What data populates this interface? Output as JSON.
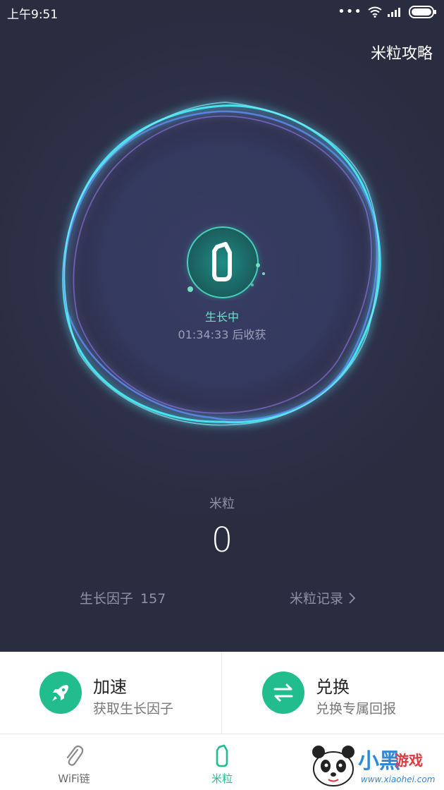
{
  "status_bar": {
    "time": "上午9:51",
    "more_icon": "more-dots-icon",
    "wifi_icon": "wifi-icon",
    "signal_icon": "signal-icon",
    "battery_icon": "battery-icon"
  },
  "header": {
    "guide_link": "米粒攻略"
  },
  "growth": {
    "state": "生长中",
    "countdown": "01:34:33 后收获"
  },
  "grain": {
    "title": "米粒",
    "value": "0"
  },
  "growth_factor": {
    "label": "生长因子",
    "value": "157"
  },
  "record_link": {
    "label": "米粒记录"
  },
  "actions": [
    {
      "title": "加速",
      "subtitle": "获取生长因子",
      "icon": "rocket-icon"
    },
    {
      "title": "兑换",
      "subtitle": "兑换专属回报",
      "icon": "exchange-icon"
    }
  ],
  "tabs": [
    {
      "label": "WiFi链",
      "icon": "paperclip-icon"
    },
    {
      "label": "米粒",
      "icon": "grain-icon"
    }
  ],
  "watermark": {
    "title": "小黑",
    "title2": "游戏",
    "url": "www.xiaohei.com"
  },
  "colors": {
    "accent": "#21bd8d",
    "background": "#2c2f45",
    "ring": "#45e4f0"
  }
}
